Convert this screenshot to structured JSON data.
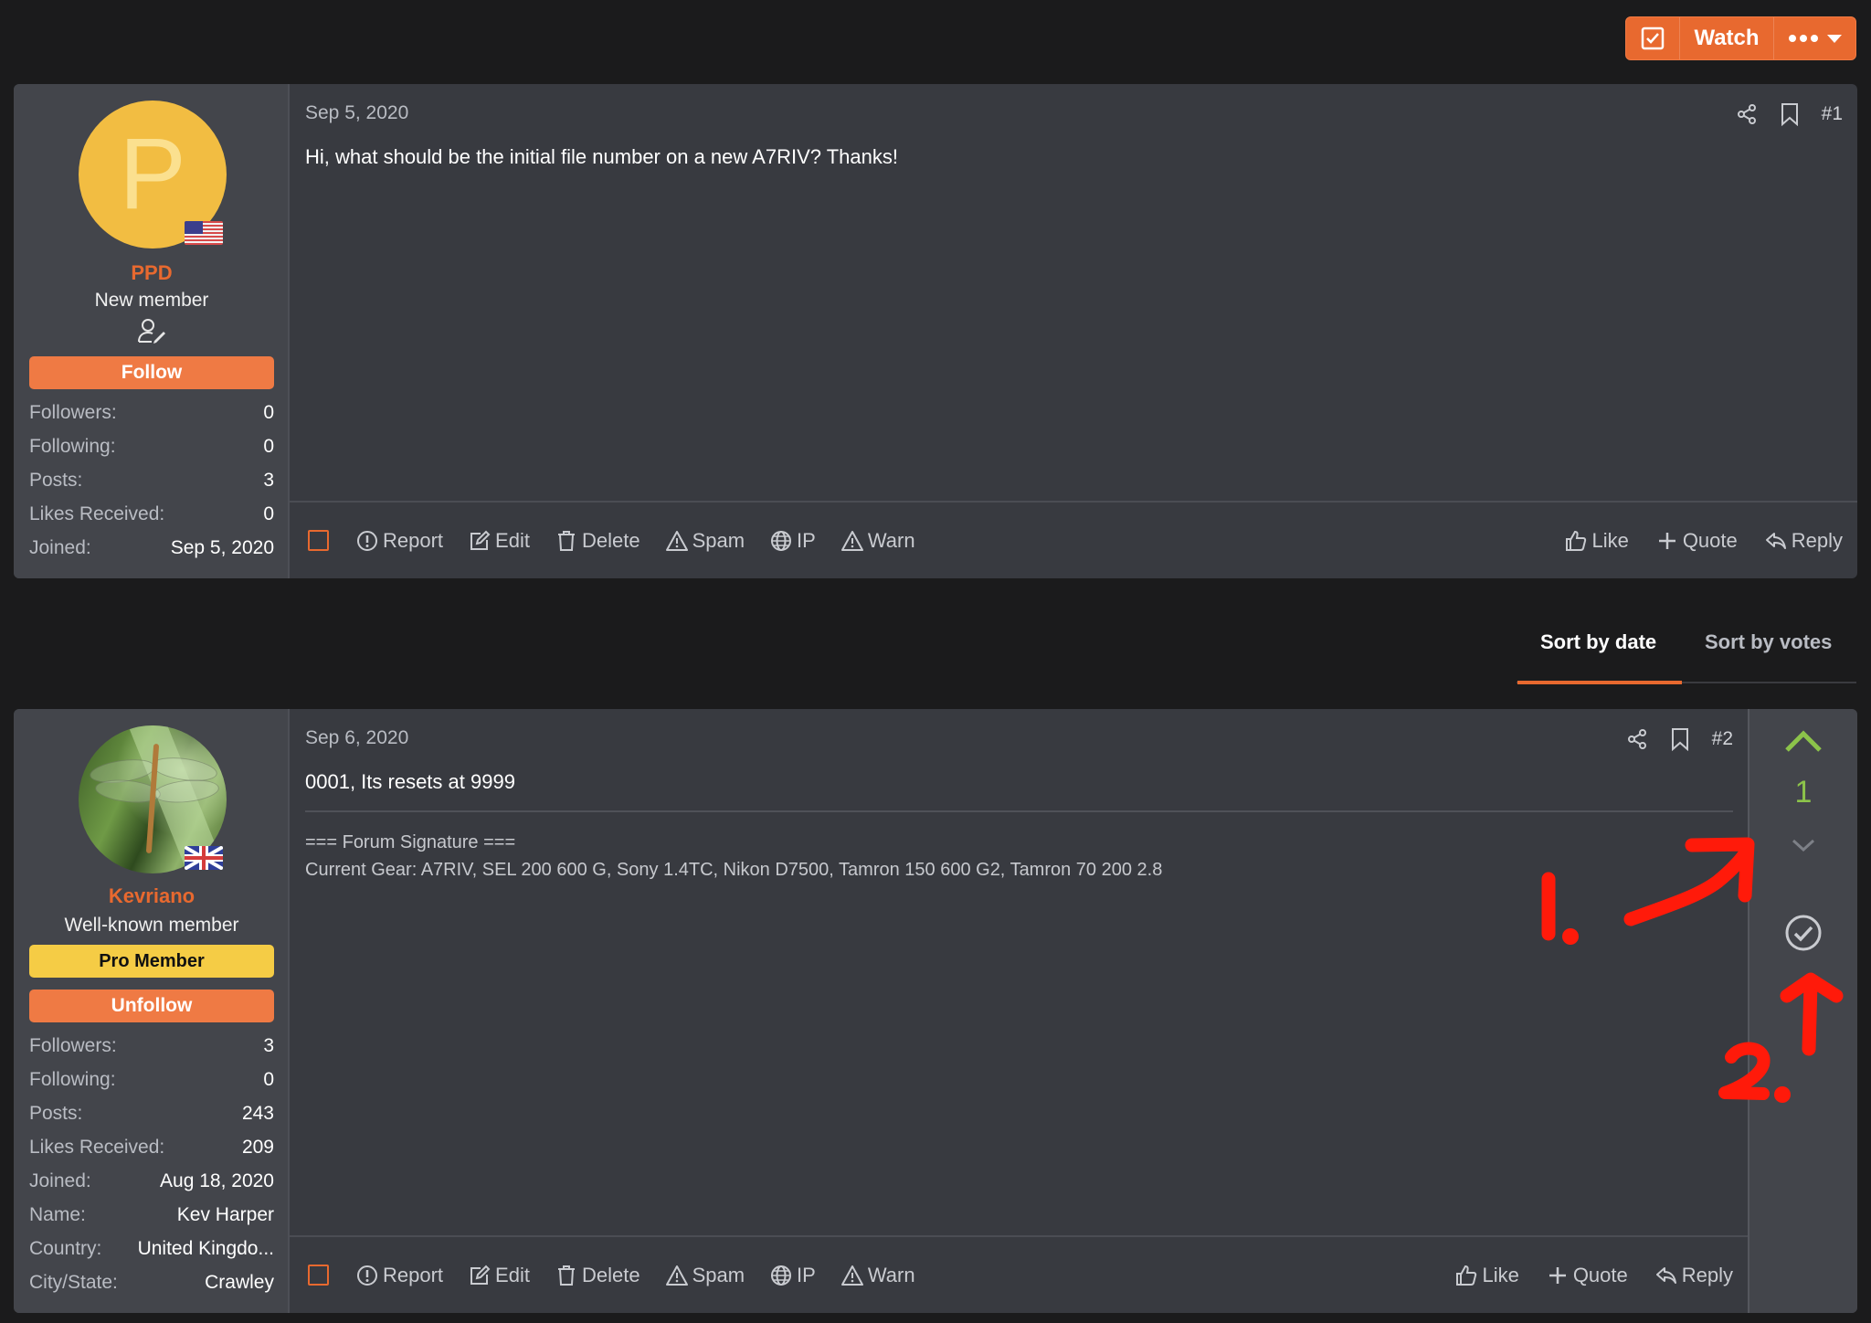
{
  "header": {
    "watch_label": "Watch",
    "icons": {
      "watch_check": "checkbox-checked-icon",
      "more": "more-dots-icon",
      "dropdown": "caret-down-icon"
    }
  },
  "colors": {
    "accent": "#e8692f",
    "follow_button": "#ef7a44",
    "pro_badge": "#f5cc45",
    "vote_positive": "#8cc34a",
    "annotation": "#ff1a0a"
  },
  "sort_tabs": {
    "active": "Sort by date",
    "inactive": "Sort by votes"
  },
  "posts": [
    {
      "number": "#1",
      "date": "Sep 5, 2020",
      "body": "Hi, what should be the initial file number on a new A7RIV? Thanks!",
      "user": {
        "avatar_letter": "P",
        "flag": "US",
        "username": "PPD",
        "title": "New member",
        "follow_label": "Follow",
        "stats": [
          {
            "label": "Followers:",
            "value": "0"
          },
          {
            "label": "Following:",
            "value": "0"
          },
          {
            "label": "Posts:",
            "value": "3"
          },
          {
            "label": "Likes Received:",
            "value": "0"
          },
          {
            "label": "Joined:",
            "value": "Sep 5, 2020"
          }
        ]
      },
      "actions_left": [
        "Report",
        "Edit",
        "Delete",
        "Spam",
        "IP",
        "Warn"
      ],
      "actions_right": [
        "Like",
        "Quote",
        "Reply"
      ]
    },
    {
      "number": "#2",
      "date": "Sep 6, 2020",
      "body": "0001, Its resets at 9999",
      "signature": {
        "heading": "=== Forum Signature ===",
        "line": "Current Gear: A7RIV, SEL 200 600 G, Sony 1.4TC, Nikon D7500, Tamron 150 600 G2, Tamron 70 200 2.8"
      },
      "user": {
        "flag": "UK",
        "username": "Kevriano",
        "title": "Well-known member",
        "badge": "Pro Member",
        "follow_label": "Unfollow",
        "stats": [
          {
            "label": "Followers:",
            "value": "3"
          },
          {
            "label": "Following:",
            "value": "0"
          },
          {
            "label": "Posts:",
            "value": "243"
          },
          {
            "label": "Likes Received:",
            "value": "209"
          },
          {
            "label": "Joined:",
            "value": "Aug 18, 2020"
          },
          {
            "label": "Name:",
            "value": "Kev Harper"
          },
          {
            "label": "Country:",
            "value": "United Kingdo..."
          },
          {
            "label": "City/State:",
            "value": "Crawley"
          }
        ]
      },
      "votes": {
        "score": "1"
      },
      "actions_left": [
        "Report",
        "Edit",
        "Delete",
        "Spam",
        "IP",
        "Warn"
      ],
      "actions_right": [
        "Like",
        "Quote",
        "Reply"
      ]
    }
  ],
  "annotations": {
    "label_1": "1.",
    "label_2": "2."
  }
}
